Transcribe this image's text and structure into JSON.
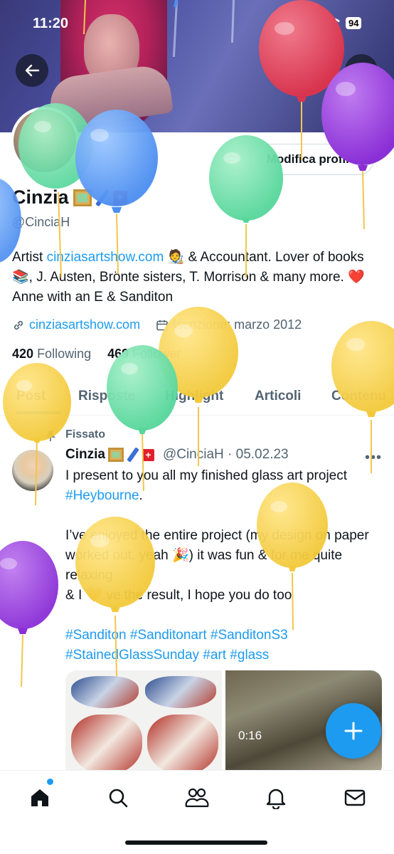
{
  "status_bar": {
    "time": "11:20",
    "battery": "94"
  },
  "profile": {
    "edit_button": "Modifica profilo",
    "name": "Cinzia",
    "handle": "@CinciaH",
    "bio_pre": "Artist ",
    "bio_link": "cinziasartshow.com",
    "bio_post": " 🧑‍🎨 & Accountant. Lover of books 📚, J. Austen, Brönte sisters, T. Morrison & many more. ❤️ Anne with an E & Sanditon",
    "website": "cinziasartshow.com",
    "joined": "Iscrizione: marzo 2012",
    "following_count": "420",
    "following_label": "Following",
    "followers_count": "469",
    "followers_label": "Follower"
  },
  "tabs": [
    "Post",
    "Risposte",
    "Highlight",
    "Articoli",
    "Contenu"
  ],
  "post": {
    "pinned_label": "Fissato",
    "author": "Cinzia",
    "meta": "@CinciaH · 05.02.23",
    "text_1": "I present to you all my finished glass art project ",
    "hashtag_1": "#Heybourne",
    "text_2": ".\n\nI’ve enjoyed the entire project (my design on paper worked out, yeah 🎉) it was fun & for me quite relaxing\n& I 🧡 ve the result, I hope you do too\n\n",
    "hashtags": "#Sanditon #Sanditonart #SanditonS3 #StainedGlassSunday #art #glass",
    "video_duration": "0:16"
  },
  "colors": {
    "accent": "#1d9bf0",
    "text": "#0f1419",
    "muted": "#536471"
  },
  "icons": [
    "back-arrow-icon",
    "search-icon",
    "link-icon",
    "calendar-icon",
    "pin-icon",
    "more-icon",
    "compose-plus-icon",
    "home-icon",
    "explore-search-icon",
    "communities-icon",
    "notifications-bell-icon",
    "messages-mail-icon"
  ]
}
